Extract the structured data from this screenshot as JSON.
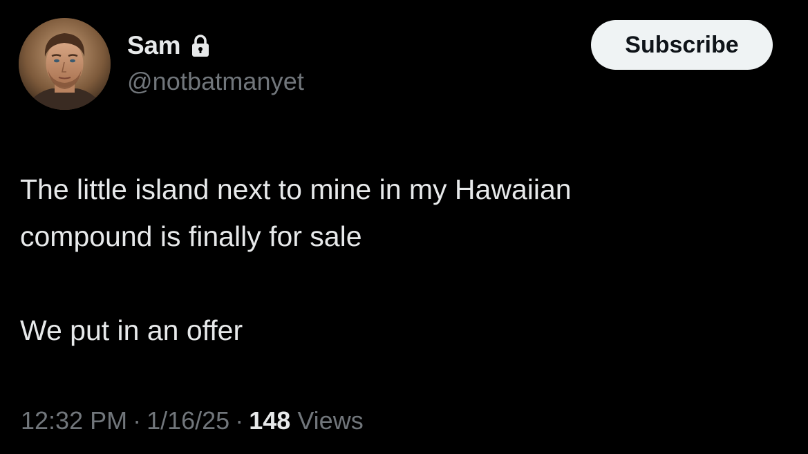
{
  "author": {
    "display_name": "Sam",
    "handle": "@notbatmanyet",
    "protected_icon": "lock-icon",
    "avatar_icon": "profile-photo"
  },
  "actions": {
    "subscribe_label": "Subscribe"
  },
  "tweet": {
    "paragraphs": [
      "The little island next to mine in my Hawaiian compound is finally for sale",
      "We put in an offer"
    ],
    "line_1": "The little island next to mine in my Hawaiian",
    "line_2": "compound is finally for sale",
    "line_3": "We put in an offer"
  },
  "meta": {
    "time": "12:32 PM",
    "date": "1/16/25",
    "separator": "·",
    "views_count": "148",
    "views_label": "Views"
  },
  "colors": {
    "background": "#000000",
    "primary_text": "#e7e9ea",
    "secondary_text": "#71767b",
    "button_bg": "#eff3f4",
    "button_text": "#0f1419"
  }
}
